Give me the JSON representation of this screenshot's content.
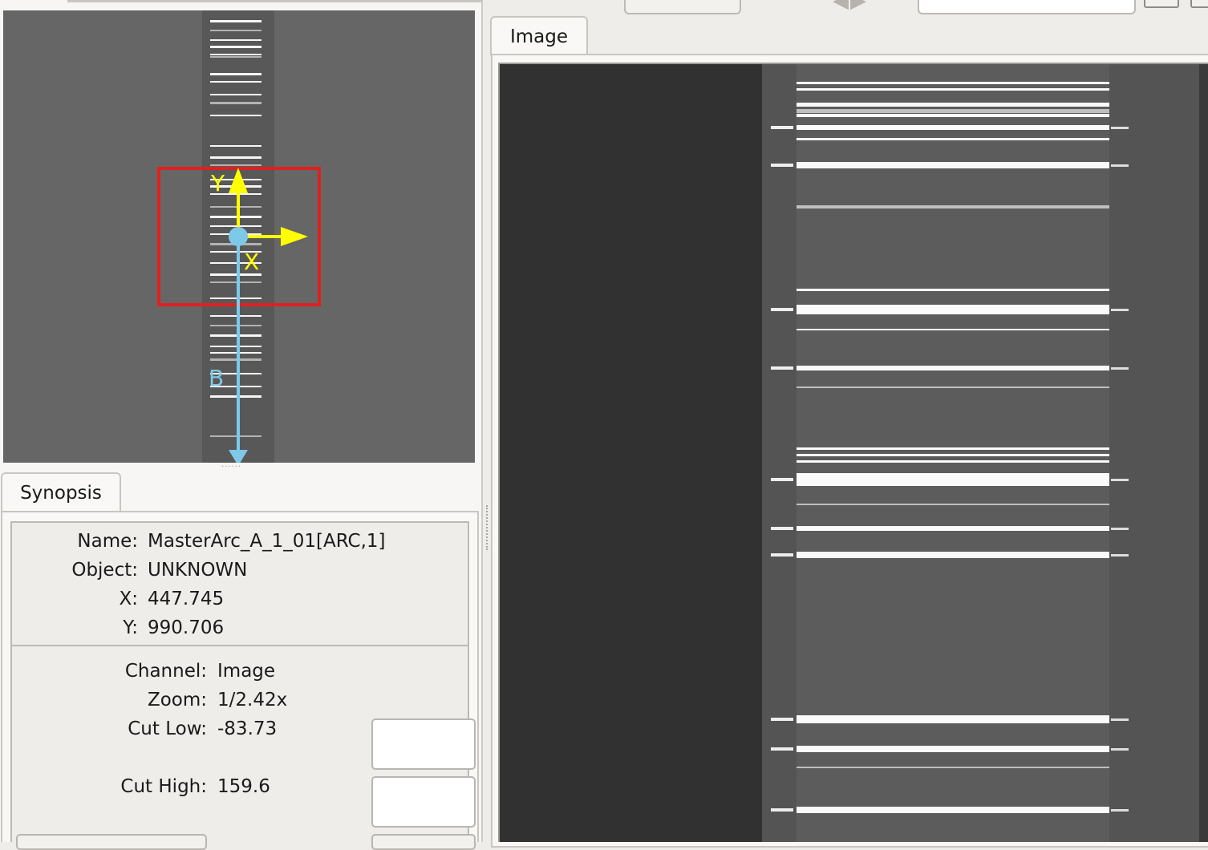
{
  "pan_view": {
    "markers": {
      "y_axis": "Y",
      "x_axis": "X",
      "b_axis": "B"
    },
    "colors": {
      "frame": "#e02020",
      "axes": "#ffff00",
      "compass": "#7ec8e8"
    }
  },
  "synopsis": {
    "tab_label": "Synopsis",
    "info": [
      {
        "label": "Name:",
        "value": "MasterArc_A_1_01[ARC,1]"
      },
      {
        "label": "Object:",
        "value": "UNKNOWN"
      },
      {
        "label": "X:",
        "value": "447.745"
      },
      {
        "label": "Y:",
        "value": "990.706"
      }
    ],
    "channel": {
      "label": "Channel:",
      "value": "Image"
    },
    "zoom": {
      "label": "Zoom:",
      "value": "1/2.42x"
    },
    "cut_low": {
      "label": "Cut Low:",
      "value": "-83.73"
    },
    "cut_high": {
      "label": "Cut High:",
      "value": "159.6"
    }
  },
  "image_panel": {
    "tab_label": "Image"
  },
  "toolbar": {
    "nav_icons": [
      "arrow-left-icon",
      "arrow-right-icon"
    ]
  }
}
